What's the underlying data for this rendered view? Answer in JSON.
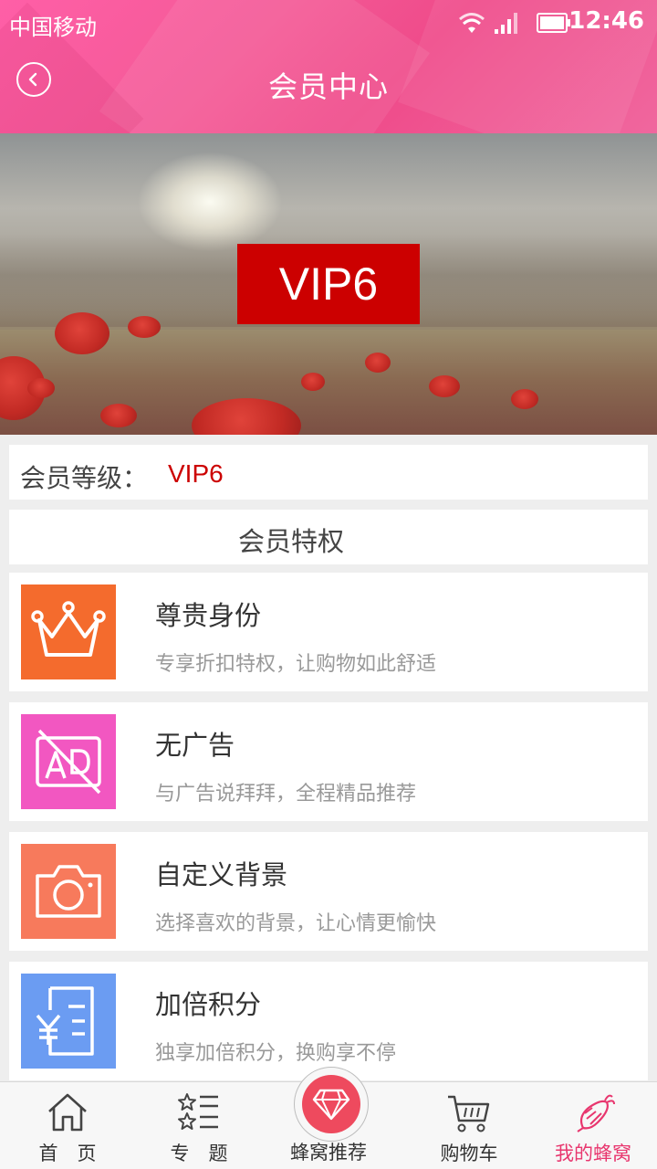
{
  "status_bar": {
    "carrier": "中国移动",
    "time": "12:46"
  },
  "header": {
    "title": "会员中心",
    "back_icon": "chevron-left-icon"
  },
  "banner": {
    "badge": "VIP6"
  },
  "level": {
    "label": "会员等级：",
    "value": "VIP6"
  },
  "privileges": {
    "title": "会员特权",
    "items": [
      {
        "title": "尊贵身份",
        "desc": "专享折扣特权，让购物如此舒适",
        "icon": "crown-icon",
        "color": "#f46b2d"
      },
      {
        "title": "无广告",
        "desc": "与广告说拜拜，全程精品推荐",
        "icon": "no-ads-icon",
        "color": "#f257c1"
      },
      {
        "title": "自定义背景",
        "desc": "选择喜欢的背景，让心情更愉快",
        "icon": "camera-icon",
        "color": "#f77a5c"
      },
      {
        "title": "加倍积分",
        "desc": "独享加倍积分，换购享不停",
        "icon": "points-icon",
        "color": "#6b9cf2"
      }
    ]
  },
  "tabbar": {
    "items": [
      {
        "label": "首　页",
        "icon": "home-icon"
      },
      {
        "label": "专　题",
        "icon": "topics-icon"
      },
      {
        "label": "蜂窝推荐",
        "icon": "diamond-icon"
      },
      {
        "label": "购物车",
        "icon": "cart-icon"
      },
      {
        "label": "我的蜂窝",
        "icon": "bee-icon"
      }
    ],
    "active_index": 4,
    "accent": "#e8366e"
  }
}
